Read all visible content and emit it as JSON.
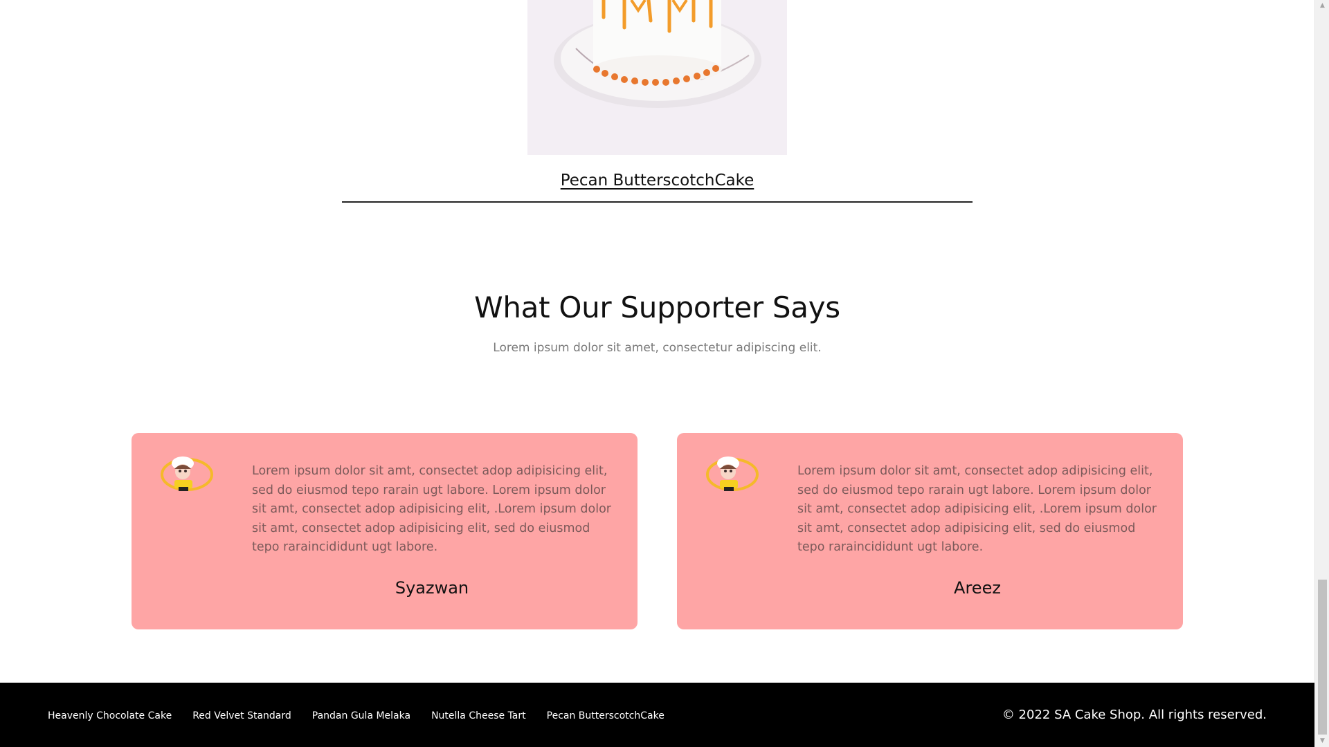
{
  "product": {
    "title": "Pecan ButterscotchCake",
    "image_icon": "cake-image"
  },
  "testimonials_section": {
    "title": "What Our Supporter Says",
    "subtitle": "Lorem ipsum dolor sit amet, consectetur adipiscing elit."
  },
  "testimonials": [
    {
      "quote": "Lorem ipsum dolor sit amt, consectet adop adipisicing elit, sed do eiusmod tepo rarain ugt labore. Lorem ipsum dolor sit amt, consectet adop adipisicing elit, .Lorem ipsum dolor sit amt, consectet adop adipisicing elit, sed do eiusmod tepo raraincididunt ugt labore.",
      "name": "Syazwan",
      "avatar_icon": "chef-avatar-icon"
    },
    {
      "quote": "Lorem ipsum dolor sit amt, consectet adop adipisicing elit, sed do eiusmod tepo rarain ugt labore. Lorem ipsum dolor sit amt, consectet adop adipisicing elit, .Lorem ipsum dolor sit amt, consectet adop adipisicing elit, sed do eiusmod tepo raraincididunt ugt labore.",
      "name": "Areez",
      "avatar_icon": "chef-avatar-icon"
    }
  ],
  "footer": {
    "links": [
      "Heavenly Chocolate Cake",
      "Red Velvet Standard",
      "Pandan Gula Melaka",
      "Nutella Cheese Tart",
      "Pecan ButterscotchCake"
    ],
    "copyright": "© 2022 SA Cake Shop. All rights reserved."
  },
  "colors": {
    "card_background": "#fea5a5",
    "footer_background": "#000000",
    "accent_orange": "#f39c2a"
  }
}
